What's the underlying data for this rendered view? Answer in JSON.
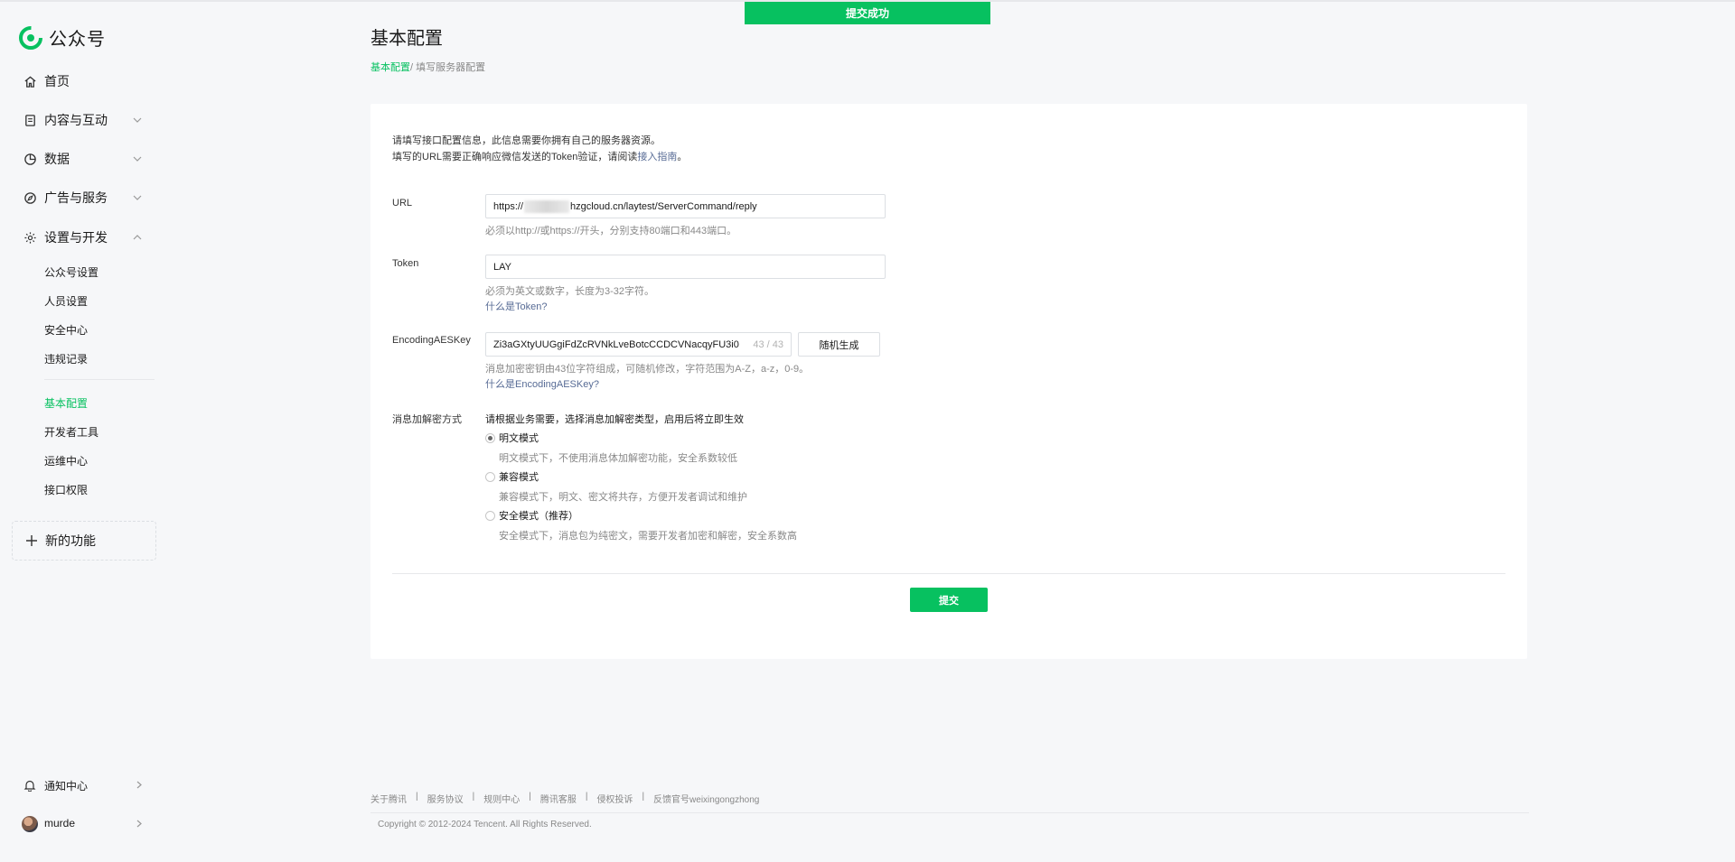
{
  "toast": {
    "text": "提交成功"
  },
  "brand": {
    "name": "公众号",
    "color": "#07c160"
  },
  "sidebar": {
    "nav": [
      {
        "label": "首页",
        "icon": "home-icon",
        "has_chevron": false
      },
      {
        "label": "内容与互动",
        "icon": "document-icon",
        "has_chevron": true,
        "expanded": false
      },
      {
        "label": "数据",
        "icon": "pie-chart-icon",
        "has_chevron": true,
        "expanded": false
      },
      {
        "label": "广告与服务",
        "icon": "compass-icon",
        "has_chevron": true,
        "expanded": false
      },
      {
        "label": "设置与开发",
        "icon": "gear-icon",
        "has_chevron": true,
        "expanded": true
      }
    ],
    "sub_items": [
      {
        "label": "公众号设置",
        "active": false
      },
      {
        "label": "人员设置",
        "active": false
      },
      {
        "label": "安全中心",
        "active": false
      },
      {
        "label": "违规记录",
        "active": false
      },
      {
        "label": "基本配置",
        "active": true
      },
      {
        "label": "开发者工具",
        "active": false
      },
      {
        "label": "运维中心",
        "active": false
      },
      {
        "label": "接口权限",
        "active": false
      }
    ],
    "new_feature": {
      "label": "新的功能",
      "icon": "plus-icon"
    },
    "notification": {
      "label": "通知中心",
      "icon": "bell-icon"
    },
    "user": {
      "name": "murde"
    }
  },
  "page": {
    "title": "基本配置",
    "breadcrumb": {
      "link": "基本配置",
      "separator": "/",
      "current": " 填写服务器配置"
    }
  },
  "form": {
    "intro_line1": "请填写接口配置信息，此信息需要你拥有自己的服务器资源。",
    "intro_line2_prefix": "填写的URL需要正确响应微信发送的Token验证，请阅读",
    "intro_link": "接入指南",
    "intro_line2_suffix": "。",
    "url": {
      "label": "URL",
      "value_prefix": "https://",
      "value_suffix": "hzgcloud.cn/laytest/ServerCommand/reply",
      "tip": "必须以http://或https://开头，分别支持80端口和443端口。"
    },
    "token": {
      "label": "Token",
      "value": "LAY",
      "tip": "必须为英文或数字，长度为3-32字符。",
      "help_link": "什么是Token?"
    },
    "aes": {
      "label": "EncodingAESKey",
      "value": "Zi3aGXtyUUGgiFdZcRVNkLveBotcCCDCVNacqyFU3i0",
      "counter": "43 / 43",
      "random_button": "随机生成",
      "tip": "消息加密密钥由43位字符组成，可随机修改，字符范围为A-Z，a-z，0-9。",
      "help_link": "什么是EncodingAESKey?"
    },
    "encryption": {
      "label": "消息加解密方式",
      "hint": "请根据业务需要，选择消息加解密类型，启用后将立即生效",
      "options": [
        {
          "label": "明文模式",
          "desc": "明文模式下，不使用消息体加解密功能，安全系数较低",
          "checked": true
        },
        {
          "label": "兼容模式",
          "desc": "兼容模式下，明文、密文将共存，方便开发者调试和维护",
          "checked": false
        },
        {
          "label": "安全模式（推荐）",
          "desc": "安全模式下，消息包为纯密文，需要开发者加密和解密，安全系数高",
          "checked": false
        }
      ]
    },
    "submit": "提交"
  },
  "footer": {
    "links": [
      "关于腾讯",
      "服务协议",
      "规则中心",
      "腾讯客服",
      "侵权投诉",
      "反馈官号weixingongzhong"
    ],
    "separator": "|",
    "copyright": "Copyright © 2012-2024 Tencent. All Rights Reserved."
  }
}
